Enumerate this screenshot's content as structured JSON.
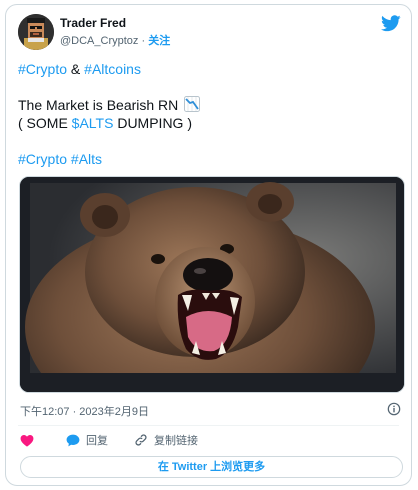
{
  "author": {
    "name": "Trader Fred",
    "handle": "@DCA_Cryptoz",
    "separator": "·",
    "follow_label": "关注"
  },
  "icons": {
    "avatar": "pixel-avatar",
    "brand": "twitter-bird-icon",
    "chart": "chart-decreasing-emoji",
    "info": "info-icon",
    "like": "heart-icon",
    "reply": "speech-bubble-icon",
    "copy_link": "link-icon"
  },
  "tweet": {
    "line1": {
      "tag1": "#Crypto",
      "amp": "&",
      "tag2": "#Altcoins"
    },
    "line2": {
      "text": "The Market is Bearish RN"
    },
    "line3": {
      "before": "( SOME ",
      "cashtag": "$ALTS",
      "after": " DUMPING )"
    },
    "line4": {
      "tag1": "#Crypto",
      "tag2": "#Alts"
    }
  },
  "timestamp": "下午12:07 · 2023年2月9日",
  "actions": {
    "reply_label": "回复",
    "copy_link_label": "复制链接"
  },
  "more_button_label": "在 Twitter 上浏览更多",
  "colors": {
    "link": "#1d9bf0",
    "like": "#f91880",
    "text": "#0f1419",
    "muted": "#536471",
    "border": "#cfd9de"
  }
}
